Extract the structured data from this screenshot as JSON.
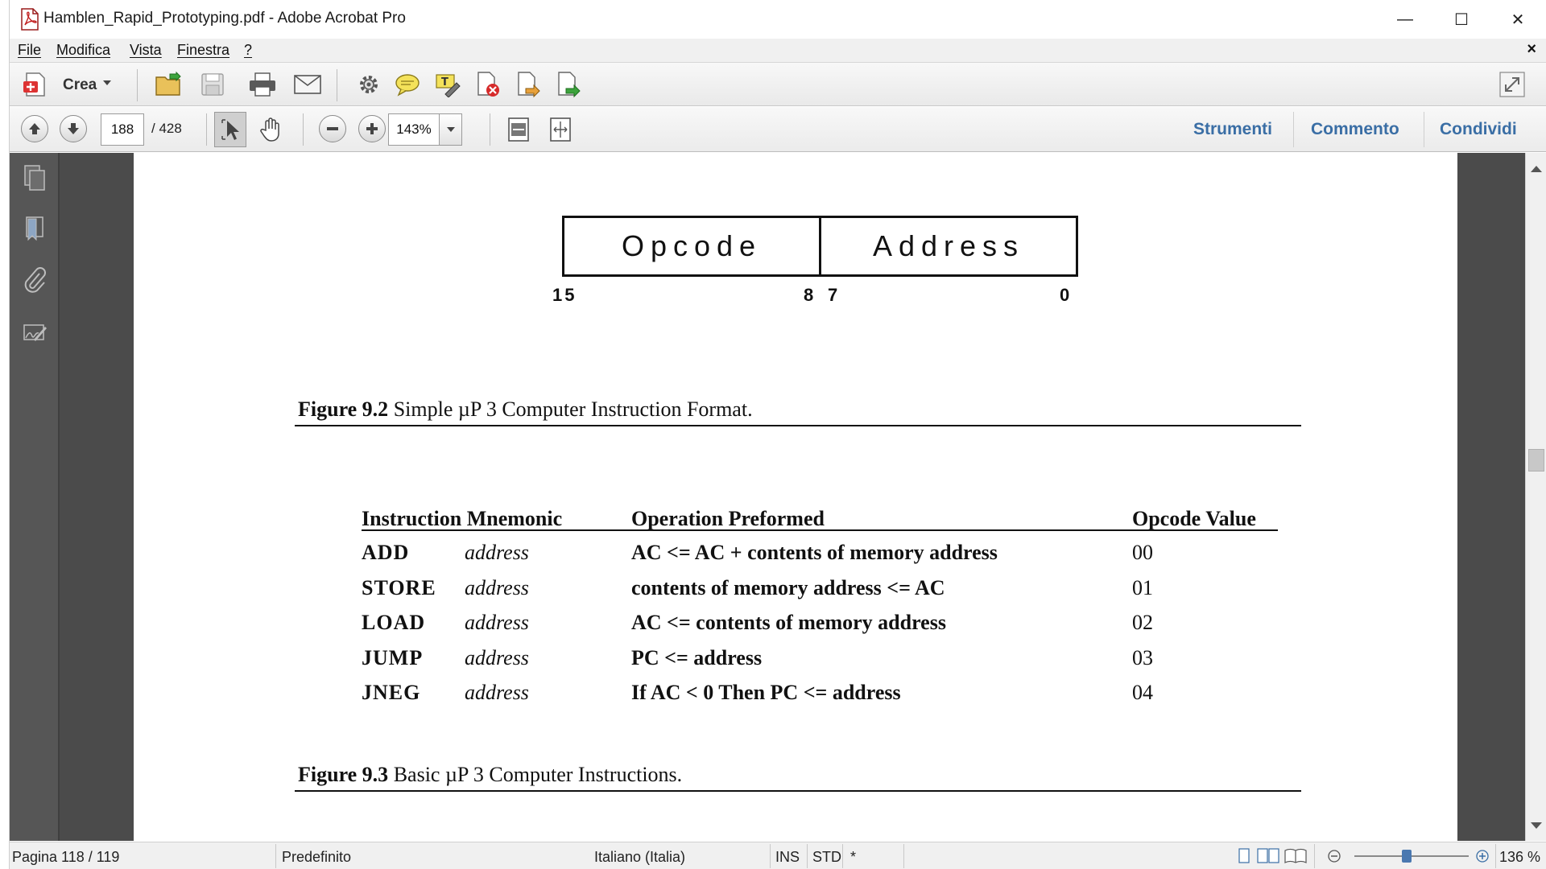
{
  "window": {
    "title": "Hamblen_Rapid_Prototyping.pdf - Adobe Acrobat Pro",
    "controls": {
      "minimize": "—",
      "maximize": "☐",
      "close": "✕"
    }
  },
  "menubar": {
    "items": [
      "File",
      "Modifica",
      "Vista",
      "Finestra",
      "?"
    ],
    "close_label": "×"
  },
  "toolbar1": {
    "create_label": "Crea"
  },
  "toolbar2": {
    "current_page": "188",
    "total_pages": "/ 428",
    "zoom": "143%",
    "links": [
      "Strumenti",
      "Commento",
      "Condividi"
    ]
  },
  "document": {
    "format_figure": {
      "fields": [
        "Opcode",
        "Address"
      ],
      "bits": {
        "msb": "15",
        "opcode_low": "8",
        "address_high": "7",
        "lsb": "0"
      }
    },
    "caption_1": {
      "label": "Figure 9.2",
      "text": " Simple µP 3 Computer Instruction Format."
    },
    "table": {
      "headers": [
        "Instruction Mnemonic",
        "Operation Preformed",
        "Opcode Value"
      ],
      "rows": [
        {
          "mnemonic": "ADD",
          "operand": "address",
          "operation": "AC <= AC + contents of memory address",
          "opcode": "00"
        },
        {
          "mnemonic": "STORE",
          "operand": "address",
          "operation": "contents of memory address <= AC",
          "opcode": "01"
        },
        {
          "mnemonic": "LOAD",
          "operand": "address",
          "operation": "AC <= contents of memory address",
          "opcode": "02"
        },
        {
          "mnemonic": "JUMP",
          "operand": "address",
          "operation": "PC <= address",
          "opcode": "03"
        },
        {
          "mnemonic": "JNEG",
          "operand": "address",
          "operation": "If AC < 0 Then PC <= address",
          "opcode": "04"
        }
      ]
    },
    "caption_2": {
      "label": "Figure 9.3",
      "text": " Basic µP 3  Computer Instructions."
    }
  },
  "statusbar": {
    "page_info": "Pagina 118 / 119",
    "style": "Predefinito",
    "language": "Italiano (Italia)",
    "ins": "INS",
    "std": "STD",
    "modified": "*",
    "zoom": "136 %"
  },
  "colors": {
    "link_blue": "#3a6ea5",
    "nav_panel": "#565656",
    "doc_background": "#4b4b4b"
  }
}
